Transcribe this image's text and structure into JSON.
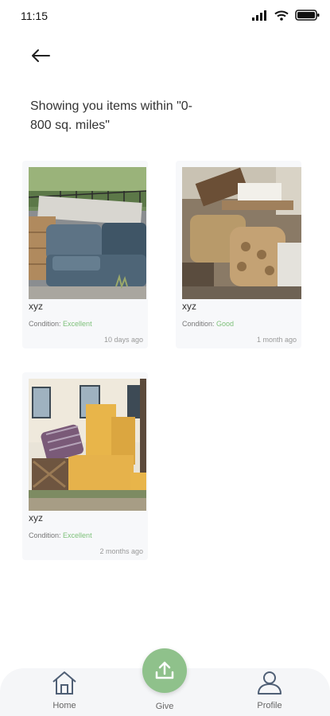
{
  "status_bar": {
    "time": "11:15"
  },
  "header": {
    "back_icon": "arrow-left-icon"
  },
  "heading": "Showing you items within  \"0-800 sq. miles\"",
  "items": [
    {
      "title": "xyz",
      "condition_label": "Condition:",
      "condition_value": "Excellent",
      "posted": "10 days ago",
      "image": "sofa-on-curb"
    },
    {
      "title": "xyz",
      "condition_label": "Condition:",
      "condition_value": "Good",
      "posted": "1 month ago",
      "image": "armchair-pile"
    },
    {
      "title": "xyz",
      "condition_label": "Condition:",
      "condition_value": "Excellent",
      "posted": "2 months ago",
      "image": "cabinet-pile"
    }
  ],
  "bottom_nav": {
    "home_label": "Home",
    "give_label": "Give",
    "profile_label": "Profile"
  },
  "colors": {
    "accent_green": "#8fc18b",
    "condition_green": "#7ec17a"
  }
}
